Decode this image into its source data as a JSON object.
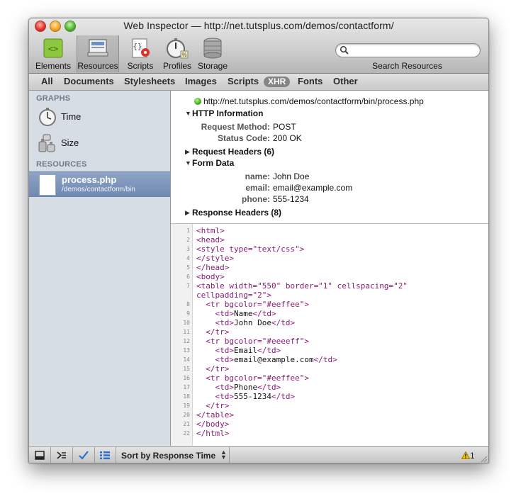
{
  "window": {
    "title": "Web Inspector — http://net.tutsplus.com/demos/contactform/"
  },
  "toolbar": {
    "tools": [
      {
        "label": "Elements",
        "icon": "elements-icon"
      },
      {
        "label": "Resources",
        "icon": "resources-icon",
        "active": true
      },
      {
        "label": "Scripts",
        "icon": "scripts-icon"
      },
      {
        "label": "Profiles",
        "icon": "profiles-icon"
      },
      {
        "label": "Storage",
        "icon": "storage-icon"
      }
    ],
    "search": {
      "label": "Search Resources",
      "value": ""
    }
  },
  "filters": [
    {
      "label": "All"
    },
    {
      "label": "Documents"
    },
    {
      "label": "Stylesheets"
    },
    {
      "label": "Images"
    },
    {
      "label": "Scripts"
    },
    {
      "label": "XHR",
      "selected": true
    },
    {
      "label": "Fonts"
    },
    {
      "label": "Other"
    }
  ],
  "sidebar": {
    "graphs_heading": "GRAPHS",
    "graphs": [
      {
        "label": "Time",
        "icon": "stopwatch-icon"
      },
      {
        "label": "Size",
        "icon": "weights-icon"
      }
    ],
    "resources_heading": "RESOURCES",
    "resources": [
      {
        "name": "process.php",
        "path": "/demos/contactform/bin",
        "selected": true
      }
    ]
  },
  "details": {
    "url": "http://net.tutsplus.com/demos/contactform/bin/process.php",
    "http_info": {
      "title": "HTTP Information",
      "expanded": true,
      "rows": [
        {
          "key": "Request Method:",
          "value": "POST"
        },
        {
          "key": "Status Code:",
          "value": "200 OK"
        }
      ]
    },
    "request_headers": {
      "title": "Request Headers (6)",
      "expanded": false
    },
    "form_data": {
      "title": "Form Data",
      "expanded": true,
      "rows": [
        {
          "key": "name:",
          "value": "John Doe"
        },
        {
          "key": "email:",
          "value": "email@example.com"
        },
        {
          "key": "phone:",
          "value": "555-1234"
        }
      ]
    },
    "response_headers": {
      "title": "Response Headers (8)",
      "expanded": false
    }
  },
  "source_lines": [
    {
      "n": "1",
      "text": "<html>"
    },
    {
      "n": "2",
      "text": "<head>"
    },
    {
      "n": "3",
      "text": "<style type=\"text/css\">"
    },
    {
      "n": "4",
      "text": "</style>"
    },
    {
      "n": "5",
      "text": "</head>"
    },
    {
      "n": "6",
      "text": "<body>"
    },
    {
      "n": "7",
      "text": "<table width=\"550\" border=\"1\" cellspacing=\"2\""
    },
    {
      "n": "",
      "text": "cellpadding=\"2\">"
    },
    {
      "n": "8",
      "text": "  <tr bgcolor=\"#eeffee\">"
    },
    {
      "n": "9",
      "text": "    <td>Name</td>"
    },
    {
      "n": "10",
      "text": "    <td>John Doe</td>"
    },
    {
      "n": "11",
      "text": "  </tr>"
    },
    {
      "n": "12",
      "text": "  <tr bgcolor=\"#eeeeff\">"
    },
    {
      "n": "13",
      "text": "    <td>Email</td>"
    },
    {
      "n": "14",
      "text": "    <td>email@example.com</td>"
    },
    {
      "n": "15",
      "text": "  </tr>"
    },
    {
      "n": "16",
      "text": "  <tr bgcolor=\"#eeffee\">"
    },
    {
      "n": "17",
      "text": "    <td>Phone</td>"
    },
    {
      "n": "18",
      "text": "    <td>555-1234</td>"
    },
    {
      "n": "19",
      "text": "  </tr>"
    },
    {
      "n": "20",
      "text": "</table>"
    },
    {
      "n": "21",
      "text": "</body>"
    },
    {
      "n": "22",
      "text": "</html>"
    }
  ],
  "statusbar": {
    "buttons": [
      {
        "icon": "dock-icon"
      },
      {
        "icon": "console-icon"
      },
      {
        "icon": "checkmark-icon"
      },
      {
        "icon": "list-icon"
      }
    ],
    "sort_label": "Sort by Response Time",
    "warning_count": "1"
  }
}
